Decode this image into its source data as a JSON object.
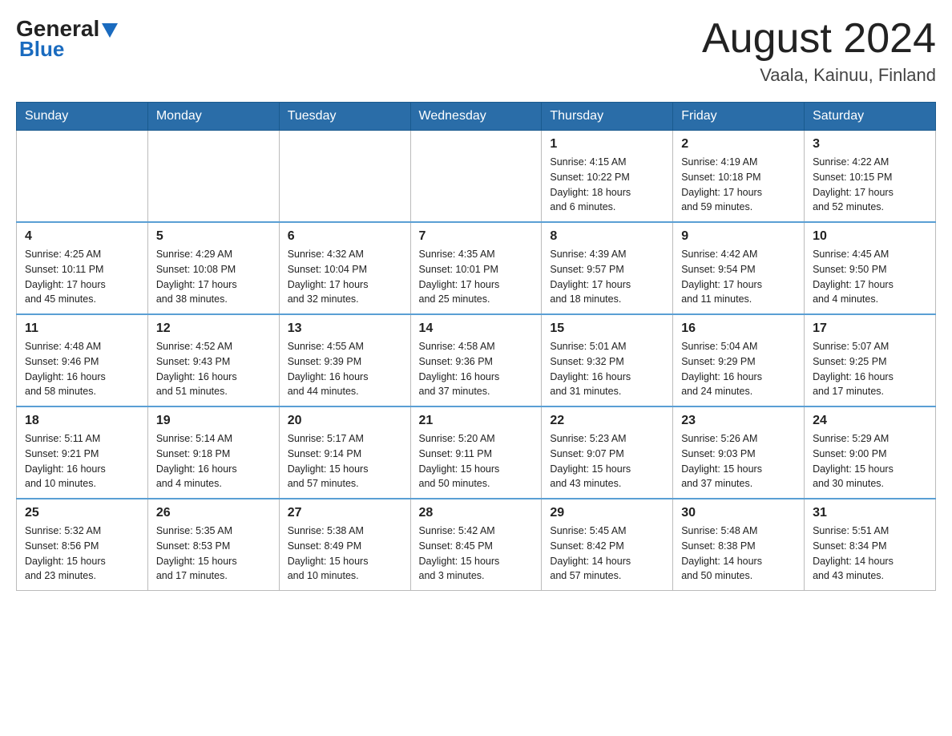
{
  "header": {
    "logo_general": "General",
    "logo_blue": "Blue",
    "month_year": "August 2024",
    "location": "Vaala, Kainuu, Finland"
  },
  "weekdays": [
    "Sunday",
    "Monday",
    "Tuesday",
    "Wednesday",
    "Thursday",
    "Friday",
    "Saturday"
  ],
  "weeks": [
    [
      {
        "day": "",
        "info": ""
      },
      {
        "day": "",
        "info": ""
      },
      {
        "day": "",
        "info": ""
      },
      {
        "day": "",
        "info": ""
      },
      {
        "day": "1",
        "info": "Sunrise: 4:15 AM\nSunset: 10:22 PM\nDaylight: 18 hours\nand 6 minutes."
      },
      {
        "day": "2",
        "info": "Sunrise: 4:19 AM\nSunset: 10:18 PM\nDaylight: 17 hours\nand 59 minutes."
      },
      {
        "day": "3",
        "info": "Sunrise: 4:22 AM\nSunset: 10:15 PM\nDaylight: 17 hours\nand 52 minutes."
      }
    ],
    [
      {
        "day": "4",
        "info": "Sunrise: 4:25 AM\nSunset: 10:11 PM\nDaylight: 17 hours\nand 45 minutes."
      },
      {
        "day": "5",
        "info": "Sunrise: 4:29 AM\nSunset: 10:08 PM\nDaylight: 17 hours\nand 38 minutes."
      },
      {
        "day": "6",
        "info": "Sunrise: 4:32 AM\nSunset: 10:04 PM\nDaylight: 17 hours\nand 32 minutes."
      },
      {
        "day": "7",
        "info": "Sunrise: 4:35 AM\nSunset: 10:01 PM\nDaylight: 17 hours\nand 25 minutes."
      },
      {
        "day": "8",
        "info": "Sunrise: 4:39 AM\nSunset: 9:57 PM\nDaylight: 17 hours\nand 18 minutes."
      },
      {
        "day": "9",
        "info": "Sunrise: 4:42 AM\nSunset: 9:54 PM\nDaylight: 17 hours\nand 11 minutes."
      },
      {
        "day": "10",
        "info": "Sunrise: 4:45 AM\nSunset: 9:50 PM\nDaylight: 17 hours\nand 4 minutes."
      }
    ],
    [
      {
        "day": "11",
        "info": "Sunrise: 4:48 AM\nSunset: 9:46 PM\nDaylight: 16 hours\nand 58 minutes."
      },
      {
        "day": "12",
        "info": "Sunrise: 4:52 AM\nSunset: 9:43 PM\nDaylight: 16 hours\nand 51 minutes."
      },
      {
        "day": "13",
        "info": "Sunrise: 4:55 AM\nSunset: 9:39 PM\nDaylight: 16 hours\nand 44 minutes."
      },
      {
        "day": "14",
        "info": "Sunrise: 4:58 AM\nSunset: 9:36 PM\nDaylight: 16 hours\nand 37 minutes."
      },
      {
        "day": "15",
        "info": "Sunrise: 5:01 AM\nSunset: 9:32 PM\nDaylight: 16 hours\nand 31 minutes."
      },
      {
        "day": "16",
        "info": "Sunrise: 5:04 AM\nSunset: 9:29 PM\nDaylight: 16 hours\nand 24 minutes."
      },
      {
        "day": "17",
        "info": "Sunrise: 5:07 AM\nSunset: 9:25 PM\nDaylight: 16 hours\nand 17 minutes."
      }
    ],
    [
      {
        "day": "18",
        "info": "Sunrise: 5:11 AM\nSunset: 9:21 PM\nDaylight: 16 hours\nand 10 minutes."
      },
      {
        "day": "19",
        "info": "Sunrise: 5:14 AM\nSunset: 9:18 PM\nDaylight: 16 hours\nand 4 minutes."
      },
      {
        "day": "20",
        "info": "Sunrise: 5:17 AM\nSunset: 9:14 PM\nDaylight: 15 hours\nand 57 minutes."
      },
      {
        "day": "21",
        "info": "Sunrise: 5:20 AM\nSunset: 9:11 PM\nDaylight: 15 hours\nand 50 minutes."
      },
      {
        "day": "22",
        "info": "Sunrise: 5:23 AM\nSunset: 9:07 PM\nDaylight: 15 hours\nand 43 minutes."
      },
      {
        "day": "23",
        "info": "Sunrise: 5:26 AM\nSunset: 9:03 PM\nDaylight: 15 hours\nand 37 minutes."
      },
      {
        "day": "24",
        "info": "Sunrise: 5:29 AM\nSunset: 9:00 PM\nDaylight: 15 hours\nand 30 minutes."
      }
    ],
    [
      {
        "day": "25",
        "info": "Sunrise: 5:32 AM\nSunset: 8:56 PM\nDaylight: 15 hours\nand 23 minutes."
      },
      {
        "day": "26",
        "info": "Sunrise: 5:35 AM\nSunset: 8:53 PM\nDaylight: 15 hours\nand 17 minutes."
      },
      {
        "day": "27",
        "info": "Sunrise: 5:38 AM\nSunset: 8:49 PM\nDaylight: 15 hours\nand 10 minutes."
      },
      {
        "day": "28",
        "info": "Sunrise: 5:42 AM\nSunset: 8:45 PM\nDaylight: 15 hours\nand 3 minutes."
      },
      {
        "day": "29",
        "info": "Sunrise: 5:45 AM\nSunset: 8:42 PM\nDaylight: 14 hours\nand 57 minutes."
      },
      {
        "day": "30",
        "info": "Sunrise: 5:48 AM\nSunset: 8:38 PM\nDaylight: 14 hours\nand 50 minutes."
      },
      {
        "day": "31",
        "info": "Sunrise: 5:51 AM\nSunset: 8:34 PM\nDaylight: 14 hours\nand 43 minutes."
      }
    ]
  ]
}
